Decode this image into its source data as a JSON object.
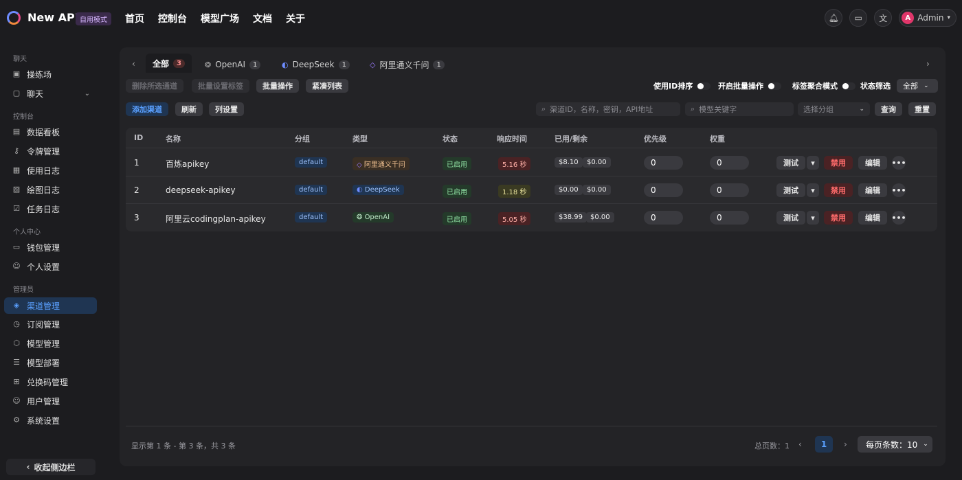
{
  "app": {
    "title": "New API",
    "mode_badge": "自用模式"
  },
  "nav": [
    "首页",
    "控制台",
    "模型广场",
    "文档",
    "关于"
  ],
  "header": {
    "user": "Admin",
    "avatar_letter": "A"
  },
  "sidebar": {
    "sections": [
      {
        "title": "聊天",
        "items": [
          {
            "label": "操练场",
            "icon": "playground-icon"
          },
          {
            "label": "聊天",
            "icon": "chat-icon",
            "expandable": true
          }
        ]
      },
      {
        "title": "控制台",
        "items": [
          {
            "label": "数据看板",
            "icon": "dashboard-icon"
          },
          {
            "label": "令牌管理",
            "icon": "key-icon"
          },
          {
            "label": "使用日志",
            "icon": "log-icon"
          },
          {
            "label": "绘图日志",
            "icon": "image-icon"
          },
          {
            "label": "任务日志",
            "icon": "task-icon"
          }
        ]
      },
      {
        "title": "个人中心",
        "items": [
          {
            "label": "钱包管理",
            "icon": "wallet-icon"
          },
          {
            "label": "个人设置",
            "icon": "user-icon"
          }
        ]
      },
      {
        "title": "管理员",
        "items": [
          {
            "label": "渠道管理",
            "icon": "layers-icon",
            "active": true
          },
          {
            "label": "订阅管理",
            "icon": "subscription-icon"
          },
          {
            "label": "模型管理",
            "icon": "box-icon"
          },
          {
            "label": "模型部署",
            "icon": "server-icon"
          },
          {
            "label": "兑换码管理",
            "icon": "gift-icon"
          },
          {
            "label": "用户管理",
            "icon": "users-icon"
          },
          {
            "label": "系统设置",
            "icon": "gear-icon"
          }
        ]
      }
    ],
    "collapse_label": "收起侧边栏"
  },
  "tabs": [
    {
      "label": "全部",
      "count": "3",
      "active": true
    },
    {
      "label": "OpenAI",
      "count": "1"
    },
    {
      "label": "DeepSeek",
      "count": "1"
    },
    {
      "label": "阿里通义千问",
      "count": "1"
    }
  ],
  "toolbar": {
    "delete_selected": "删除所选通道",
    "batch_tags": "批量设置标签",
    "batch_ops": "批量操作",
    "compact_list": "紧凑列表",
    "sort_by_id": "使用ID排序",
    "enable_batch": "开启批量操作",
    "tag_aggregate": "标签聚合模式",
    "status_filter": "状态筛选",
    "status_value": "全部",
    "add_channel": "添加渠道",
    "refresh": "刷新",
    "column_settings": "列设置",
    "search_placeholder": "渠道ID，名称，密钥，API地址",
    "model_placeholder": "模型关键字",
    "group_placeholder": "选择分组",
    "query": "查询",
    "reset": "重置"
  },
  "table": {
    "headers": [
      "ID",
      "名称",
      "分组",
      "类型",
      "状态",
      "响应时间",
      "已用/剩余",
      "优先级",
      "权重"
    ],
    "rows": [
      {
        "id": "1",
        "name": "百炼apikey",
        "group": "default",
        "type": "阿里通义千问",
        "type_kind": "qw",
        "status": "已启用",
        "resp": "5.16 秒",
        "resp_kind": "slow",
        "used": "$8.10",
        "remain": "$0.00",
        "priority": "0",
        "weight": "0"
      },
      {
        "id": "2",
        "name": "deepseek-apikey",
        "group": "default",
        "type": "DeepSeek",
        "type_kind": "ds",
        "status": "已启用",
        "resp": "1.18 秒",
        "resp_kind": "ok",
        "used": "$0.00",
        "remain": "$0.00",
        "priority": "0",
        "weight": "0"
      },
      {
        "id": "3",
        "name": "阿里云codingplan-apikey",
        "group": "default",
        "type": "OpenAI",
        "type_kind": "oa",
        "status": "已启用",
        "resp": "5.05 秒",
        "resp_kind": "slow",
        "used": "$38.99",
        "remain": "$0.00",
        "priority": "0",
        "weight": "0"
      }
    ],
    "actions": {
      "test": "测试",
      "disable": "禁用",
      "edit": "编辑"
    }
  },
  "pagination": {
    "info": "显示第 1 条 - 第 3 条，共 3 条",
    "total": "总页数：1",
    "current": "1",
    "page_size": "每页条数：10"
  }
}
